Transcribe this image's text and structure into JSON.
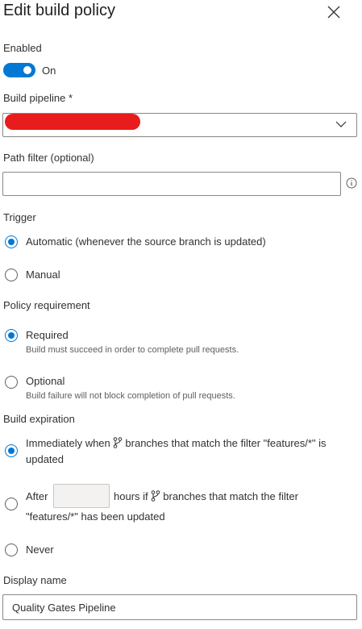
{
  "panel": {
    "title": "Edit build policy"
  },
  "enabled": {
    "label": "Enabled",
    "toggle_state": "On"
  },
  "build_pipeline": {
    "label": "Build pipeline *",
    "value": ""
  },
  "path_filter": {
    "label": "Path filter (optional)",
    "value": "",
    "placeholder": ""
  },
  "trigger": {
    "label": "Trigger",
    "options": [
      {
        "label": "Automatic (whenever the source branch is updated)",
        "selected": true
      },
      {
        "label": "Manual",
        "selected": false
      }
    ]
  },
  "policy_requirement": {
    "label": "Policy requirement",
    "options": [
      {
        "label": "Required",
        "description": "Build must succeed in order to complete pull requests.",
        "selected": true
      },
      {
        "label": "Optional",
        "description": "Build failure will not block completion of pull requests.",
        "selected": false
      }
    ]
  },
  "build_expiration": {
    "label": "Build expiration",
    "immediately": {
      "text_prefix": "Immediately when",
      "text_line1": "branches that match the filter \"features/*\" is",
      "text_line2": "updated",
      "selected": true
    },
    "after": {
      "text_prefix": "After",
      "hours_value": "",
      "text_mid": "hours if",
      "text_line1": "branches that match the filter",
      "text_line2": "\"features/*\" has been updated",
      "selected": false
    },
    "never": {
      "label": "Never",
      "selected": false
    }
  },
  "display_name": {
    "label": "Display name",
    "value": "Quality Gates Pipeline"
  },
  "colors": {
    "accent": "#0078d4",
    "redaction": "#e81c1c",
    "border": "#8a8886"
  },
  "icons": [
    "close-icon",
    "chevron-down-icon",
    "info-icon",
    "branch-icon"
  ]
}
